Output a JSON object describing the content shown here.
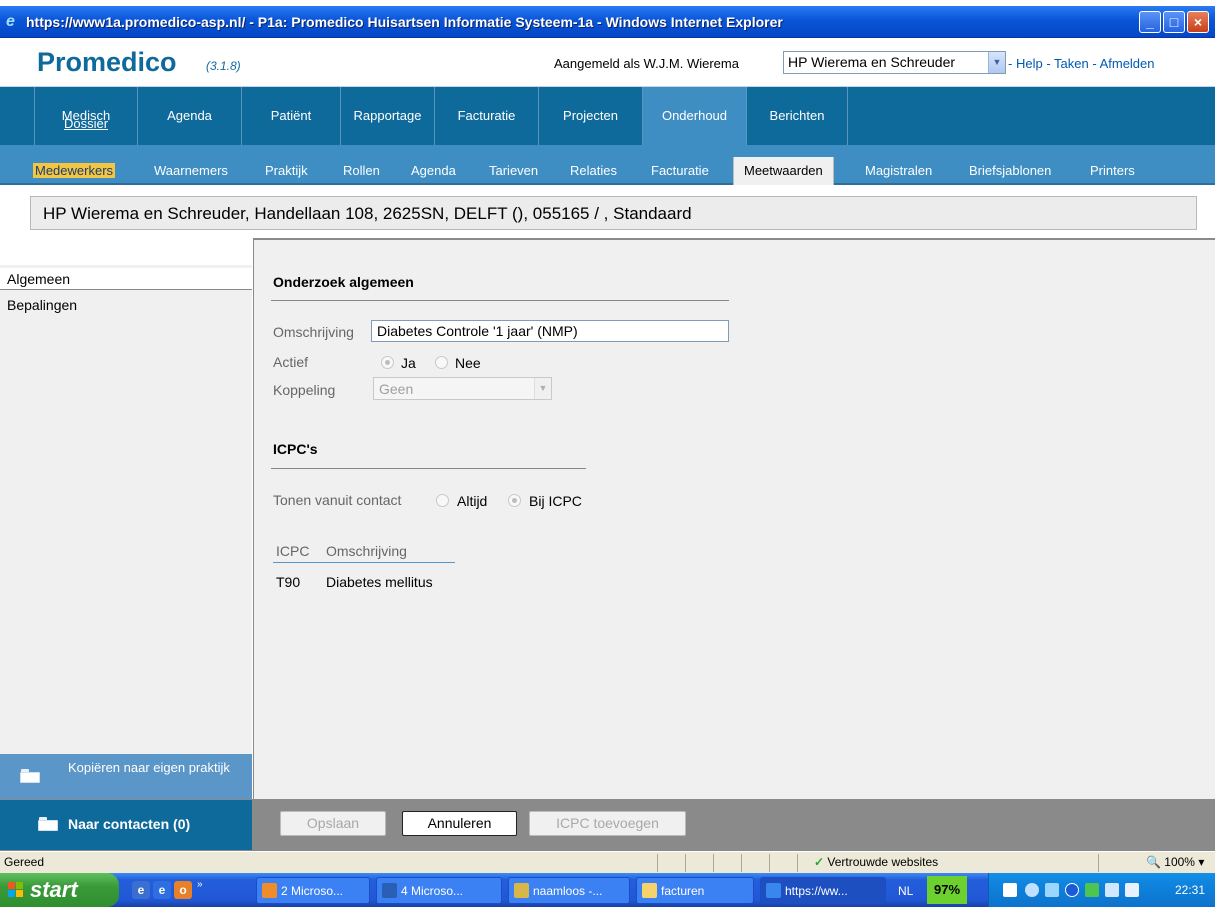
{
  "window": {
    "title": "https://www1a.promedico-asp.nl/ - P1a: Promedico Huisartsen Informatie Systeem-1a - Windows Internet Explorer",
    "buttons": [
      "minimize",
      "maximize",
      "close"
    ]
  },
  "header": {
    "brand": "Promedico",
    "version": "(3.1.8)",
    "logged_in_label": "Aangemeld als W.J.M. Wierema",
    "practice": "HP Wierema en Schreuder",
    "links": [
      "Help",
      "Taken",
      "Afmelden"
    ]
  },
  "mainnav": {
    "items": [
      {
        "l1": "Medisch",
        "l2": "Dossier"
      },
      {
        "label": "Agenda"
      },
      {
        "label": "Patiënt"
      },
      {
        "label": "Rapportage"
      },
      {
        "label": "Facturatie"
      },
      {
        "label": "Projecten"
      },
      {
        "label": "Onderhoud"
      },
      {
        "label": "Berichten"
      }
    ],
    "active": "Onderhoud"
  },
  "subnav": {
    "items": [
      "Medewerkers",
      "Waarnemers",
      "Praktijk",
      "Rollen",
      "Agenda",
      "Tarieven",
      "Relaties",
      "Facturatie",
      "Meetwaarden",
      "Magistralen",
      "Briefsjablonen",
      "Printers"
    ],
    "active": "Meetwaarden",
    "highlighted": "Medewerkers"
  },
  "infobar": "HP Wierema en Schreuder, Handellaan 108, 2625SN, DELFT (), 055165 / , Standaard",
  "leftpanel": {
    "items": [
      "Algemeen",
      "Bepalingen"
    ],
    "selected": "Algemeen",
    "copy_action": "Kopiëren naar eigen praktijk"
  },
  "form": {
    "section1": "Onderzoek algemeen",
    "omschrijving_label": "Omschrijving",
    "omschrijving_value": "Diabetes Controle '1 jaar' (NMP)",
    "actief_label": "Actief",
    "actief_options": [
      "Ja",
      "Nee"
    ],
    "actief_selected": "Ja",
    "koppeling_label": "Koppeling",
    "koppeling_value": "Geen",
    "section2": "ICPC's",
    "tonen_label": "Tonen vanuit contact",
    "tonen_options": [
      "Altijd",
      "Bij ICPC"
    ],
    "tonen_selected": "Bij ICPC",
    "table": {
      "headers": [
        "ICPC",
        "Omschrijving"
      ],
      "rows": [
        [
          "T90",
          "Diabetes mellitus"
        ]
      ]
    }
  },
  "footer": {
    "naar_contacten": "Naar contacten (0)",
    "buttons": {
      "opslaan": "Opslaan",
      "annuleren": "Annuleren",
      "icpc_toevoegen": "ICPC toevoegen"
    }
  },
  "statusbar": {
    "status": "Gereed",
    "zone": "Vertrouwde websites",
    "zoom": "100%"
  },
  "taskbar": {
    "start": "start",
    "tasks": [
      "2 Microso...",
      "4 Microso...",
      "naamloos -...",
      "facturen",
      "https://ww..."
    ],
    "lang": "NL",
    "battery": "97%",
    "clock": "22:31"
  },
  "colors": {
    "nav_dark": "#0f6a9c",
    "nav_light": "#3e8ec4",
    "highlight": "#f4c542"
  }
}
